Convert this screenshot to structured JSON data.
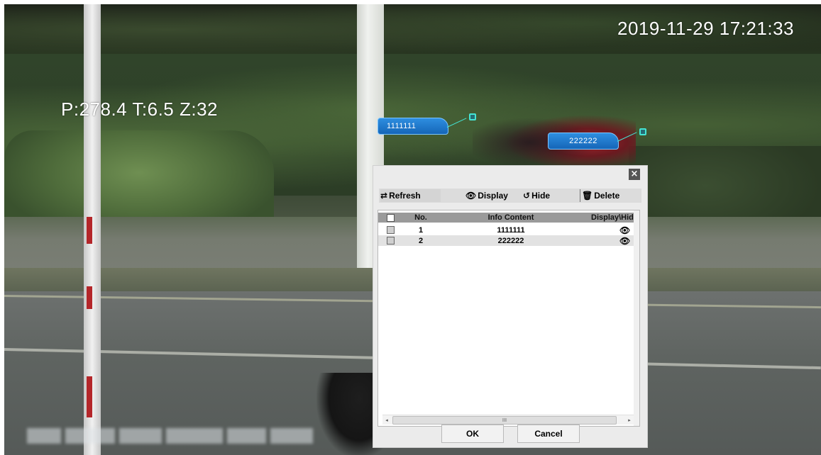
{
  "osd": {
    "datetime": "2019-11-29 17:21:33",
    "ptz": "P:278.4 T:6.5 Z:32"
  },
  "video_labels": [
    {
      "text": "1111111"
    },
    {
      "text": "222222"
    }
  ],
  "dialog": {
    "close_icon": "close-icon",
    "toolbar": {
      "refresh": {
        "icon": "⇄",
        "label": "Refresh"
      },
      "display": {
        "icon": "👁",
        "label": "Display"
      },
      "hide": {
        "icon": "↺",
        "label": "Hide"
      },
      "delete": {
        "icon": "🗑",
        "label": "Delete"
      }
    },
    "table": {
      "columns": [
        "No.",
        "Info Content",
        "Display\\Hide"
      ],
      "rows": [
        {
          "no": "1",
          "info": "1111111",
          "status_icon": "eye-icon"
        },
        {
          "no": "2",
          "info": "222222",
          "status_icon": "eye-icon"
        }
      ]
    },
    "ok_label": "OK",
    "cancel_label": "Cancel"
  },
  "colors": {
    "label_fill": "#1e78cc",
    "label_line": "#44e4d4",
    "dialog_bg": "#ebebeb",
    "header_bg": "#9a9a9a"
  }
}
